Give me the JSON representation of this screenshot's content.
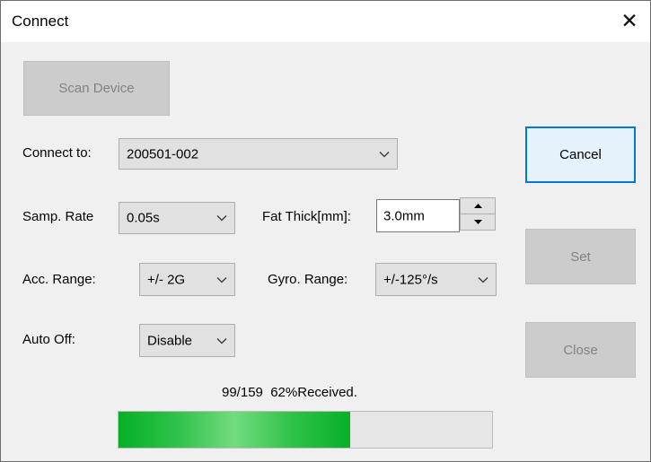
{
  "window": {
    "title": "Connect",
    "close_glyph": "✕"
  },
  "buttons": {
    "scan_device": "Scan Device",
    "cancel": "Cancel",
    "set": "Set",
    "close": "Close"
  },
  "connect_to": {
    "label": "Connect to:",
    "value": "200501-002"
  },
  "samp_rate": {
    "label": "Samp. Rate",
    "value": "0.05s"
  },
  "fat_thick": {
    "label": "Fat Thick[mm]:",
    "value": "3.0mm"
  },
  "acc_range": {
    "label": "Acc. Range:",
    "value": "+/- 2G"
  },
  "gyro_range": {
    "label": "Gyro. Range:",
    "value": "+/-125°/s"
  },
  "auto_off": {
    "label": "Auto Off:",
    "value": "Disable"
  },
  "progress": {
    "status_text": "99/159  62%Received.",
    "received": 99,
    "total": 159,
    "percent": 62,
    "fill_color": "#06b025"
  },
  "colors": {
    "default_button_border": "#0078d7",
    "default_button_bg": "#e5f1fb"
  },
  "icons": {
    "dropdown": "chevron-down-icon",
    "spin_up": "triangle-up-icon",
    "spin_down": "triangle-down-icon",
    "close": "close-icon"
  }
}
